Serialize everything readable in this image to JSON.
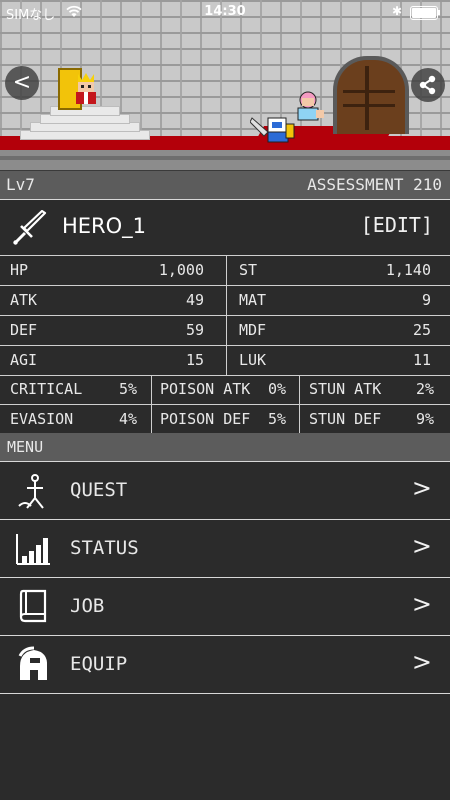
{
  "status_bar": {
    "carrier": "SIMなし",
    "time": "14:30"
  },
  "nav": {
    "back_label": "<"
  },
  "level_bar": {
    "level": "Lv7",
    "assessment": "ASSESSMENT 210"
  },
  "hero": {
    "name": "HERO_1",
    "edit_label": "[EDIT]"
  },
  "stats": {
    "primary": [
      [
        {
          "label": "HP",
          "value": "1,000"
        },
        {
          "label": "ST",
          "value": "1,140"
        }
      ],
      [
        {
          "label": "ATK",
          "value": "49"
        },
        {
          "label": "MAT",
          "value": "9"
        }
      ],
      [
        {
          "label": "DEF",
          "value": "59"
        },
        {
          "label": "MDF",
          "value": "25"
        }
      ],
      [
        {
          "label": "AGI",
          "value": "15"
        },
        {
          "label": "LUK",
          "value": "11"
        }
      ]
    ],
    "secondary": [
      [
        {
          "label": "CRITICAL",
          "value": "5%"
        },
        {
          "label": "POISON ATK",
          "value": "0%"
        },
        {
          "label": "STUN ATK",
          "value": "2%"
        }
      ],
      [
        {
          "label": "EVASION",
          "value": "4%"
        },
        {
          "label": "POISON DEF",
          "value": "5%"
        },
        {
          "label": "STUN DEF",
          "value": "9%"
        }
      ]
    ]
  },
  "menu": {
    "header": "MENU",
    "items": [
      {
        "label": "QUEST",
        "icon": "quest-icon",
        "chevron": ">"
      },
      {
        "label": "STATUS",
        "icon": "status-bars-icon",
        "chevron": ">"
      },
      {
        "label": "JOB",
        "icon": "book-icon",
        "chevron": ">"
      },
      {
        "label": "EQUIP",
        "icon": "helmet-icon",
        "chevron": ">"
      }
    ]
  },
  "colors": {
    "background": "#2b2b2b",
    "bar": "#5c5c5c",
    "divider": "#cfcfcf",
    "carpet": "#b3000a"
  }
}
